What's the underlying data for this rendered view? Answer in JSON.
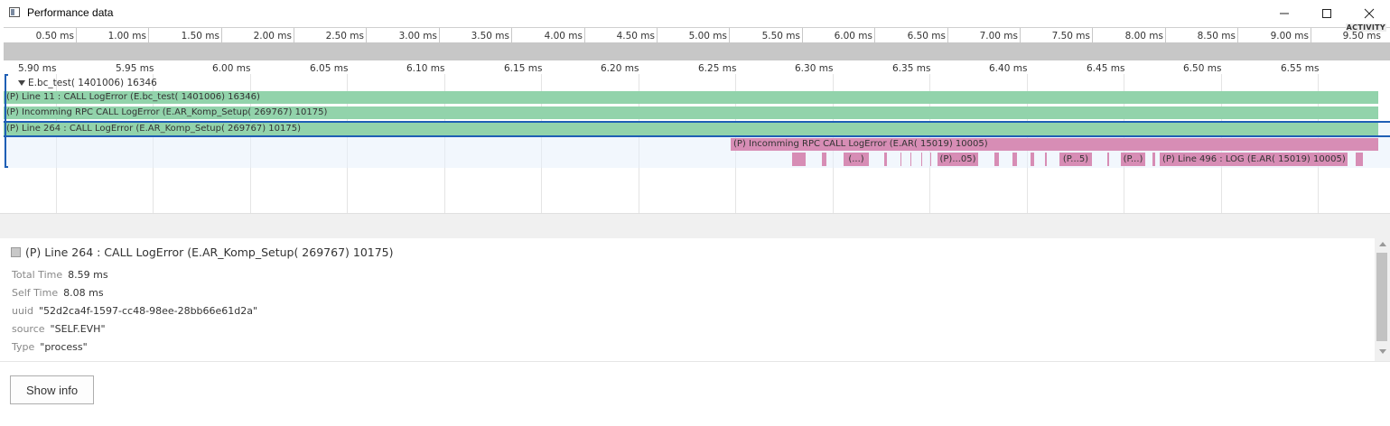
{
  "window": {
    "title": "Performance data",
    "icons": [
      "app-window-icon",
      "minimize-icon",
      "maximize-icon",
      "close-icon"
    ]
  },
  "overview": {
    "ticks": [
      "0.50 ms",
      "1.00 ms",
      "1.50 ms",
      "2.00 ms",
      "2.50 ms",
      "3.00 ms",
      "3.50 ms",
      "4.00 ms",
      "4.50 ms",
      "5.00 ms",
      "5.50 ms",
      "6.00 ms",
      "6.50 ms",
      "7.00 ms",
      "7.50 ms",
      "8.00 ms",
      "8.50 ms",
      "9.00 ms",
      "9.50 ms"
    ],
    "activity_label": "ACTIVITY"
  },
  "timeline": {
    "ticks": [
      "5.90 ms",
      "5.95 ms",
      "6.00 ms",
      "6.05 ms",
      "6.10 ms",
      "6.15 ms",
      "6.20 ms",
      "6.25 ms",
      "6.30 ms",
      "6.35 ms",
      "6.40 ms",
      "6.45 ms",
      "6.50 ms",
      "6.55 ms"
    ],
    "group_label": "E.bc_test( 1401006) 16346",
    "rows": [
      {
        "label": "(P) Line  11 : CALL LogError (E.bc_test( 1401006) 16346)",
        "color": "#92d3ab"
      },
      {
        "label": "(P) Incomming RPC CALL LogError (E.AR_Komp_Setup( 269767) 10175)",
        "color": "#92d3ab"
      },
      {
        "label": "(P) Line  264 : CALL LogError (E.AR_Komp_Setup( 269767) 10175)",
        "color": "#92d3ab"
      },
      {
        "label": "(P) Incomming RPC CALL LogError (E.AR( 15019) 10005)",
        "color": "#d78db5"
      }
    ],
    "segments": [
      "(...)",
      "(P)...05)",
      "(P...5)",
      "(P...)",
      "(P) Line  496 : LOG (E.AR( 15019) 10005)"
    ]
  },
  "info": {
    "title": "(P) Line  264 : CALL LogError (E.AR_Komp_Setup( 269767) 10175)",
    "properties": [
      {
        "key": "Total Time",
        "value": "8.59 ms"
      },
      {
        "key": "Self Time",
        "value": "8.08 ms"
      },
      {
        "key": "uuid",
        "value": "\"52d2ca4f-1597-cc48-98ee-28bb66e61d2a\""
      },
      {
        "key": "source",
        "value": "\"SELF.EVH\""
      },
      {
        "key": "Type",
        "value": "\"process\""
      }
    ]
  },
  "actions": {
    "show_info_label": "Show info"
  }
}
